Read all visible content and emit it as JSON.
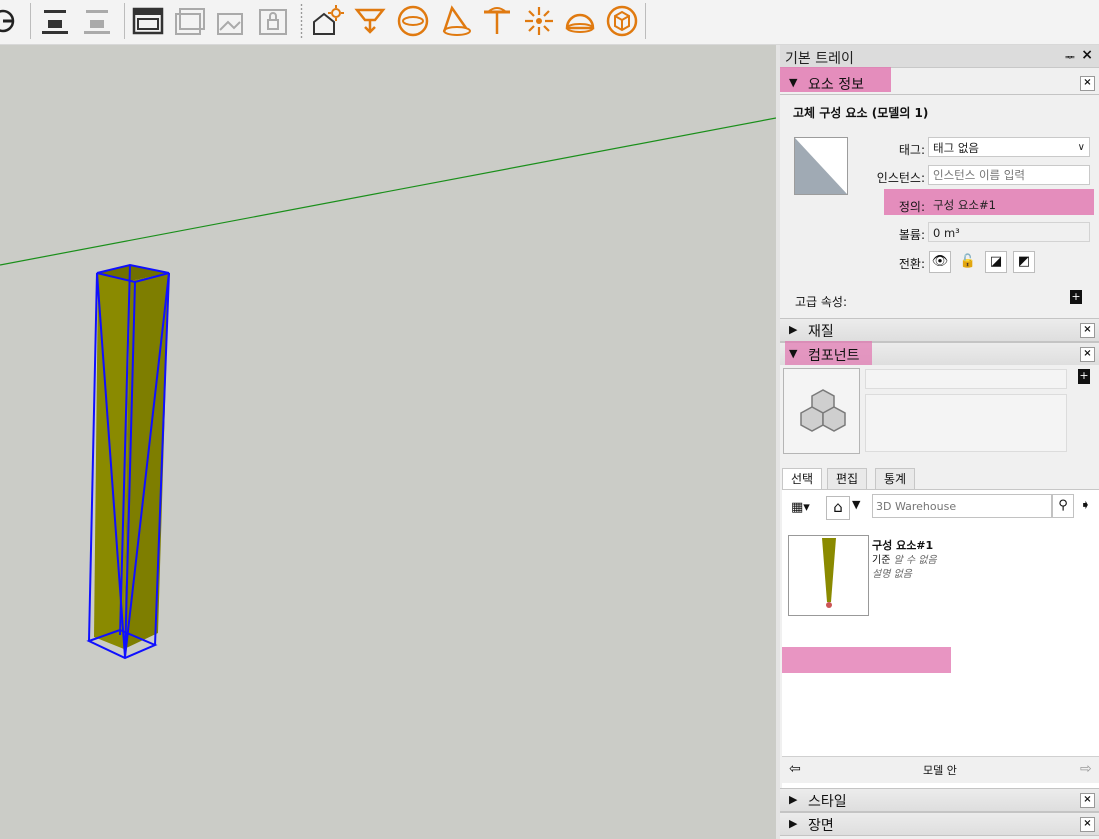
{
  "toolbar": {
    "icons": [
      "orbit-icon",
      "section-plane-icon",
      "section-display-icon",
      "window-camera-icon",
      "component-window-icon",
      "window-icon",
      "lock-window-icon",
      "scene-light-icon",
      "light-spot-icon",
      "sphere-icon",
      "cone-light-icon",
      "lamp-icon",
      "sun-burst-icon",
      "dome-icon",
      "box-icon"
    ],
    "accent": "#e07a10"
  },
  "viewport": {
    "background": "#cbccc7",
    "axis_color": "#1a8f1a",
    "object_color": "#8a8a00",
    "selection_color": "#1010ff"
  },
  "tray": {
    "title": "기본 트레이",
    "pin": "ᆓ",
    "close": "×"
  },
  "entity_info": {
    "header": "요소 정보",
    "subtitle": "고체 구성 요소 (모델의 1)",
    "tag_label": "태그:",
    "tag_value": "태그 없음",
    "instance_label": "인스턴스:",
    "instance_placeholder": "인스턴스 이름 입력",
    "definition_label": "정의:",
    "definition_value": "구성 요소#1",
    "volume_label": "볼륨:",
    "volume_value": "0 m³",
    "toggle_label": "전환:",
    "advanced_label": "고급 속성:"
  },
  "materials": {
    "header": "재질"
  },
  "components": {
    "header": "컴포넌트",
    "tabs": [
      "선택",
      "편집",
      "통계"
    ],
    "active_tab": 0,
    "search_placeholder": "3D Warehouse",
    "item": {
      "title": "구성 요소#1",
      "line2_prefix": "기준",
      "line2_value": "알 수 없음",
      "line3": "설명 없음"
    },
    "nav_label": "모델 안"
  },
  "styles": {
    "header": "스타일"
  },
  "scenes": {
    "header": "장면"
  },
  "highlight_color": "#e27bb3"
}
